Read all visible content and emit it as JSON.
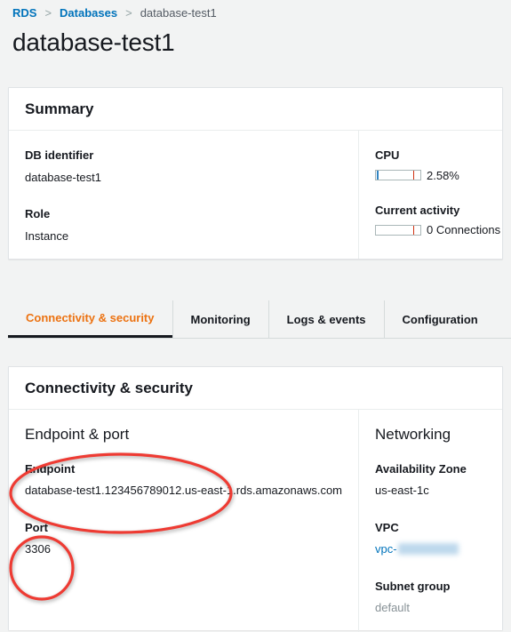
{
  "breadcrumb": {
    "items": [
      {
        "label": "RDS",
        "type": "link"
      },
      {
        "label": "Databases",
        "type": "link"
      },
      {
        "label": "database-test1",
        "type": "current"
      }
    ],
    "separator": ">"
  },
  "page": {
    "title": "database-test1"
  },
  "summary": {
    "title": "Summary",
    "fields": [
      {
        "label": "DB identifier",
        "value": "database-test1"
      },
      {
        "label": "Role",
        "value": "Instance"
      }
    ],
    "metrics": [
      {
        "label": "CPU",
        "value": "2.58%"
      },
      {
        "label": "Current activity",
        "value": "0 Connections"
      }
    ]
  },
  "tabs": [
    {
      "label": "Connectivity & security",
      "active": true
    },
    {
      "label": "Monitoring",
      "active": false
    },
    {
      "label": "Logs & events",
      "active": false
    },
    {
      "label": "Configuration",
      "active": false
    }
  ],
  "connectivity": {
    "title": "Connectivity & security",
    "endpoint_section": {
      "title": "Endpoint & port",
      "endpoint_label": "Endpoint",
      "endpoint_value": "database-test1.123456789012.us-east-1.rds.amazonaws.com",
      "port_label": "Port",
      "port_value": "3306"
    },
    "networking_section": {
      "title": "Networking",
      "az_label": "Availability Zone",
      "az_value": "us-east-1c",
      "vpc_label": "VPC",
      "vpc_value_prefix": "vpc-",
      "subnet_label": "Subnet group",
      "subnet_value": "default"
    }
  },
  "colors": {
    "accent_orange": "#ec7211",
    "link_blue": "#0073bb",
    "annotation_red": "#ee3b33",
    "page_bg": "#f2f3f3",
    "gauge_red": "#d13212",
    "gauge_blue": "#3184c2"
  }
}
